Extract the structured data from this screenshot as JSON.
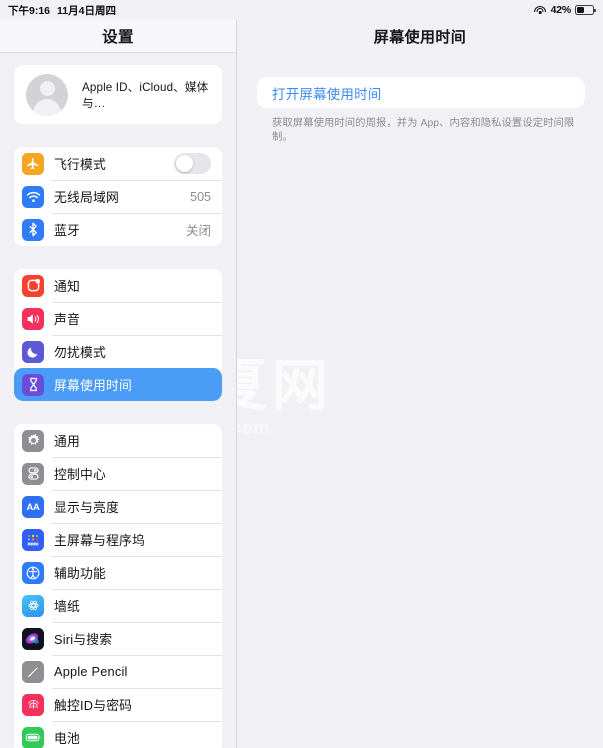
{
  "statusbar": {
    "time": "下午9:16",
    "date": "11月4日周四",
    "wifi_icon": "wifi-icon",
    "battery_percent": "42%",
    "battery_level": 42,
    "battery_icon": "battery-icon"
  },
  "sidebar": {
    "title": "设置",
    "account": {
      "avatar_icon": "person-avatar-icon",
      "label": "Apple ID、iCloud、媒体与…"
    },
    "groups": [
      {
        "id": "connectivity",
        "items": [
          {
            "label": "飞行模式",
            "icon": "airplane-icon",
            "icon_bg": "#f5a623",
            "control": "toggle",
            "toggle_on": false
          },
          {
            "label": "无线局域网",
            "icon": "wifi-icon",
            "icon_bg": "#2f7cf6",
            "value": "505"
          },
          {
            "label": "蓝牙",
            "icon": "bluetooth-icon",
            "icon_bg": "#2f7cf6",
            "value": "关闭"
          }
        ]
      },
      {
        "id": "alerts",
        "items": [
          {
            "label": "通知",
            "icon": "notifications-icon",
            "icon_bg": "#f8402f"
          },
          {
            "label": "声音",
            "icon": "sound-icon",
            "icon_bg": "#f4315c"
          },
          {
            "label": "勿扰模式",
            "icon": "moon-icon",
            "icon_bg": "#5b59d6"
          },
          {
            "label": "屏幕使用时间",
            "icon": "hourglass-icon",
            "icon_bg": "#6b4ddb",
            "selected": true
          }
        ]
      },
      {
        "id": "system",
        "items": [
          {
            "label": "通用",
            "icon": "gear-icon",
            "icon_bg": "#8e8e93"
          },
          {
            "label": "控制中心",
            "icon": "control-center-icon",
            "icon_bg": "#8e8e93"
          },
          {
            "label": "显示与亮度",
            "icon": "display-brightness-icon",
            "icon_bg": "#2f6ff6"
          },
          {
            "label": "主屏幕与程序坞",
            "icon": "home-screen-dock-icon",
            "icon_bg": "#2f5ff6"
          },
          {
            "label": "辅助功能",
            "icon": "accessibility-icon",
            "icon_bg": "#2f7cf6"
          },
          {
            "label": "墙纸",
            "icon": "wallpaper-icon",
            "icon_bg": "#3ab0f0"
          },
          {
            "label": "Siri与搜索",
            "icon": "siri-icon",
            "icon_bg": "#1c1c2e"
          },
          {
            "label": "Apple Pencil",
            "icon": "pencil-icon",
            "icon_bg": "#8e8e93"
          },
          {
            "label": "触控ID与密码",
            "icon": "touch-id-icon",
            "icon_bg": "#f4315c"
          },
          {
            "label": "电池",
            "icon": "battery-icon",
            "icon_bg": "#34c759"
          }
        ]
      }
    ]
  },
  "detail": {
    "title": "屏幕使用时间",
    "action_label": "打开屏幕使用时间",
    "action_color": "#3b8cf4",
    "note": "获取屏幕使用时间的周报，并为 App、内容和隐私设置设定时间限制。"
  },
  "watermark": {
    "cn": "顽夏网",
    "en": "wanxiaw.com"
  }
}
